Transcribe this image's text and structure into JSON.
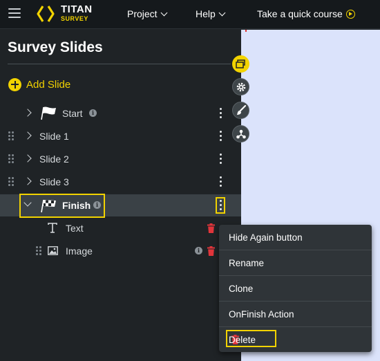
{
  "header": {
    "brand_name": "TITAN",
    "brand_sub": "SURVEY",
    "nav": [
      "Project",
      "Help"
    ],
    "course_label": "Take a quick course"
  },
  "panel": {
    "title": "Survey Slides",
    "add_slide_label": "Add Slide",
    "slides": [
      {
        "label": "Start",
        "info": "i"
      },
      {
        "label": "Slide 1"
      },
      {
        "label": "Slide 2"
      },
      {
        "label": "Slide 3"
      },
      {
        "label": "Finish",
        "info": "i",
        "expanded": true,
        "selected": true
      }
    ],
    "children": [
      {
        "label": "Text",
        "icon": "text-icon"
      },
      {
        "label": "Image",
        "icon": "image-icon",
        "info": "i"
      }
    ]
  },
  "tools": [
    "layers-icon",
    "gear-icon",
    "brush-icon",
    "share-icon"
  ],
  "context_menu": {
    "items": [
      "Hide Again button",
      "Rename",
      "Clone",
      "OnFinish Action"
    ],
    "delete_label": "Delete"
  },
  "colors": {
    "accent": "#f2d300",
    "danger": "#d84b4b",
    "canvas": "#dbe3fb",
    "panel": "#1f2326"
  }
}
